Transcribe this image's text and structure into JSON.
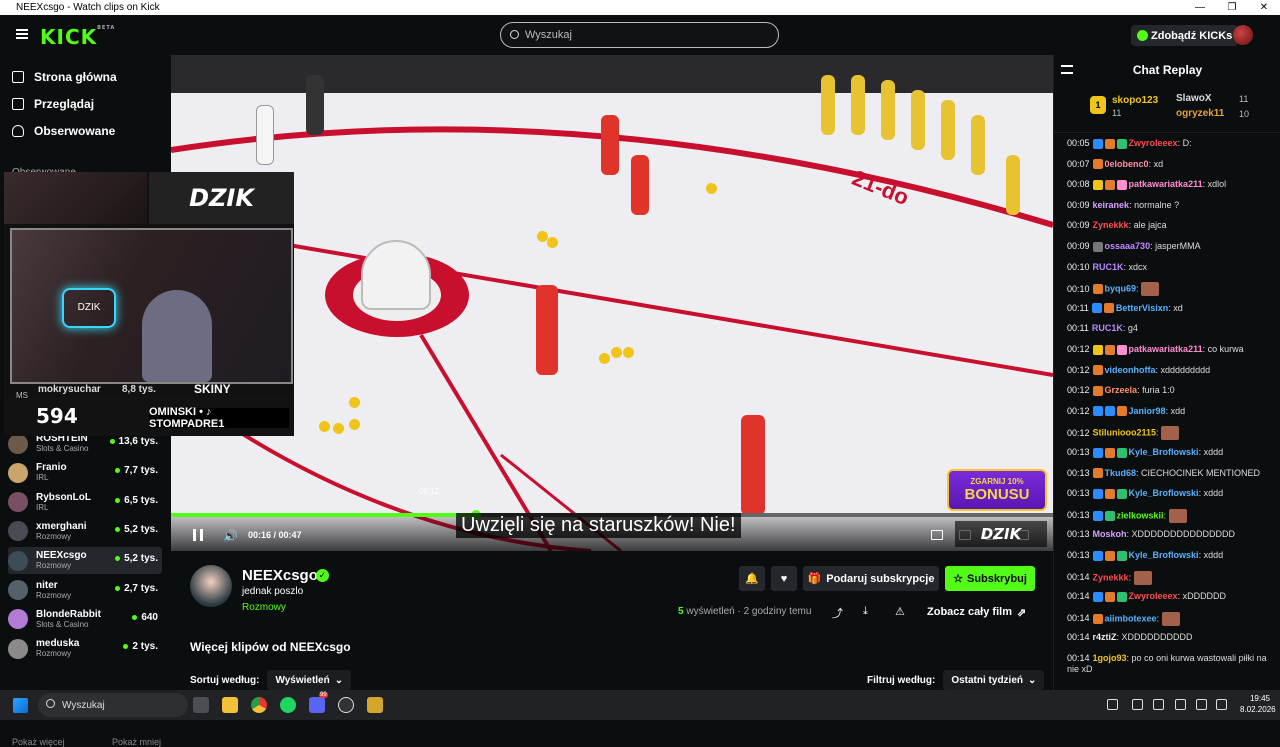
{
  "window": {
    "title": "NEEXcsgo - Watch clips on Kick",
    "controls": [
      "—",
      "❐",
      "✕"
    ]
  },
  "header": {
    "logo": "KICK",
    "logo_badge": "BETA",
    "search_placeholder": "Wyszukaj",
    "kicks_label": "Zdobądź KICKs"
  },
  "sidebar": {
    "nav": [
      {
        "label": "Strona główna",
        "icon": "home-icon"
      },
      {
        "label": "Przeglądaj",
        "icon": "browse-icon"
      },
      {
        "label": "Obserwowane",
        "icon": "heart-icon"
      }
    ],
    "followed_title": "Obserwowane",
    "overlay_row": {
      "name": "mokrysuchar",
      "viewers": "8,8 tys."
    },
    "channels": [
      {
        "name": "ROSHTEIN",
        "category": "Slots & Casino",
        "viewers": "13,6 tys.",
        "color": "#6b5a4a"
      },
      {
        "name": "Franio",
        "category": "IRL",
        "viewers": "7,7 tys.",
        "color": "#c9a46b"
      },
      {
        "name": "RybsonLoL",
        "category": "IRL",
        "viewers": "6,5 tys.",
        "color": "#7a4f63"
      },
      {
        "name": "xmerghani",
        "category": "Rozmowy",
        "viewers": "5,2 tys.",
        "color": "#4a4a55"
      },
      {
        "name": "NEEXcsgo",
        "category": "Rozmowy",
        "viewers": "5,2 tys.",
        "color": "#3d4d58",
        "active": true
      },
      {
        "name": "niter",
        "category": "Rozmowy",
        "viewers": "2,7 tys.",
        "color": "#55606a"
      },
      {
        "name": "BlondeRabbit",
        "category": "Slots & Casino",
        "viewers": "640",
        "color": "#b47bd6"
      },
      {
        "name": "meduska",
        "category": "Rozmowy",
        "viewers": "2 tys.",
        "color": "#8a8a8a"
      }
    ],
    "show_more": "Pokaż więcej",
    "show_less": "Pokaż mniej"
  },
  "overlay": {
    "banner": "DZIK",
    "counter": "594",
    "counter_label": "MS",
    "skiny": "SKINY",
    "tag": "OMINSKI • ♪ STOMPADRE1",
    "neon": "DZIK"
  },
  "video": {
    "caption": "Uwzięli się na staruszków! Nie!",
    "time": "00:16 / 00:47",
    "hover_time": "00:12",
    "progress": 0.346,
    "bonus_line1": "ZGARNIJ 10%",
    "bonus_line2": "BONUSU",
    "watermark": "DZIK",
    "court_text": "21-do"
  },
  "channel": {
    "name": "NEEXcsgo",
    "title": "jednak poszlo",
    "category": "Rozmowy",
    "views_count": "5",
    "views_label": "wyświetleń",
    "time_ago": "· 2 godziny temu",
    "gift_label": "Podaruj subskrypcje",
    "subscribe_label": "Subskrybuj",
    "full_film_label": "Zobacz cały film"
  },
  "clips": {
    "title": "Więcej klipów od NEEXcsgo",
    "sort_label": "Sortuj według:",
    "sort_value": "Wyświetleń",
    "filter_label": "Filtruj według:",
    "filter_value": "Ostatni tydzień"
  },
  "chat": {
    "title": "Chat Replay",
    "leaderboard": [
      {
        "rank": "1",
        "name": "skopo123",
        "value": "11"
      },
      {
        "name": "SlawoX",
        "value": "11"
      },
      {
        "name": "ogryzek11",
        "value": "10"
      }
    ],
    "messages": [
      {
        "t": "00:05",
        "user": "Zwyroleeex",
        "text": ": D:",
        "color": "#ff4d4d",
        "badges": [
          "#2b8cff",
          "#e37b2a",
          "#2fbf71"
        ]
      },
      {
        "t": "00:07",
        "user": "0elobenc0",
        "text": ": xd",
        "color": "#ff8fa3",
        "badges": [
          "#e37b2a"
        ]
      },
      {
        "t": "00:08",
        "user": "patkawariatka211",
        "text": ": xdlol",
        "color": "#ff8fd0",
        "badges": [
          "#f0c419",
          "#e37b2a",
          "#ff8fd0"
        ]
      },
      {
        "t": "00:09",
        "user": "keiranek",
        "text": ": normalne ?",
        "color": "#d6a0ff",
        "badges": []
      },
      {
        "t": "00:09",
        "user": "Zynekkk",
        "text": ": ale jajca",
        "color": "#ff4d4d",
        "badges": []
      },
      {
        "t": "00:09",
        "user": "ossaaa730",
        "text": ": jasperMMA",
        "color": "#c58aff",
        "badges": [
          "#777"
        ]
      },
      {
        "t": "00:10",
        "user": "RUC1K",
        "text": ": xdcx",
        "color": "#b98aff",
        "badges": []
      },
      {
        "t": "00:10",
        "user": "byqu69",
        "text": ":",
        "color": "#5ab0ff",
        "badges": [
          "#e37b2a"
        ],
        "emote": true
      },
      {
        "t": "00:11",
        "user": "BetterVisixn",
        "text": ": xd",
        "color": "#5ab0ff",
        "badges": [
          "#2b8cff",
          "#e37b2a"
        ]
      },
      {
        "t": "00:11",
        "user": "RUC1K",
        "text": ": g4",
        "color": "#b98aff",
        "badges": []
      },
      {
        "t": "00:12",
        "user": "patkawariatka211",
        "text": ": co kurwa",
        "color": "#ff8fd0",
        "badges": [
          "#f0c419",
          "#e37b2a",
          "#ff8fd0"
        ]
      },
      {
        "t": "00:12",
        "user": "videonhoffa",
        "text": ": xddddddddd",
        "color": "#5ab0ff",
        "badges": [
          "#e37b2a"
        ]
      },
      {
        "t": "00:12",
        "user": "Grzeela",
        "text": ": furia 1:0",
        "color": "#ff8f6b",
        "badges": [
          "#e37b2a"
        ]
      },
      {
        "t": "00:12",
        "user": "Janior98",
        "text": ": xdd",
        "color": "#5ab0ff",
        "badges": [
          "#2b8cff",
          "#2b8cff",
          "#e37b2a"
        ]
      },
      {
        "t": "00:12",
        "user": "Stiluniooo2115",
        "text": ":",
        "color": "#f0c419",
        "badges": [],
        "emote": true
      },
      {
        "t": "00:13",
        "user": "Kyle_Broflowski",
        "text": ": xddd",
        "color": "#5ab0ff",
        "badges": [
          "#2b8cff",
          "#e37b2a",
          "#2fbf71"
        ]
      },
      {
        "t": "00:13",
        "user": "Tkud68",
        "text": ": CIECHOCINEK MENTIONED",
        "color": "#5ab0ff",
        "badges": [
          "#e37b2a"
        ]
      },
      {
        "t": "00:13",
        "user": "Kyle_Broflowski",
        "text": ": xddd",
        "color": "#5ab0ff",
        "badges": [
          "#2b8cff",
          "#e37b2a",
          "#2fbf71"
        ]
      },
      {
        "t": "00:13",
        "user": "zielkowskii",
        "text": ":",
        "color": "#53fc18",
        "badges": [
          "#2b8cff",
          "#2fbf71"
        ],
        "emote": true
      },
      {
        "t": "00:13",
        "user": "Moskoh",
        "text": ": XDDDDDDDDDDDDDDD",
        "color": "#d6a0ff",
        "badges": []
      },
      {
        "t": "00:13",
        "user": "Kyle_Broflowski",
        "text": ": xddd",
        "color": "#5ab0ff",
        "badges": [
          "#2b8cff",
          "#e37b2a",
          "#2fbf71"
        ]
      },
      {
        "t": "00:14",
        "user": "Zynekkk",
        "text": ":",
        "color": "#ff4d4d",
        "badges": [],
        "emote": true
      },
      {
        "t": "00:14",
        "user": "Zwyroleeex",
        "text": ": xDDDDDD",
        "color": "#ff4d4d",
        "badges": [
          "#2b8cff",
          "#e37b2a",
          "#2fbf71"
        ]
      },
      {
        "t": "00:14",
        "user": "aiimbotexee",
        "text": ":",
        "color": "#5ab0ff",
        "badges": [
          "#e37b2a"
        ],
        "emote": true
      },
      {
        "t": "00:14",
        "user": "r4ztiZ",
        "text": ": XDDDDDDDDDD",
        "color": "#eee",
        "badges": []
      },
      {
        "t": "00:14",
        "user": "1gojo93",
        "text": ": po co oni kurwa wastowali piłki na nie xD",
        "color": "#f0c419",
        "badges": []
      }
    ]
  },
  "taskbar": {
    "search_placeholder": "Wyszukaj",
    "time": "19:45",
    "date": "8.02.2026",
    "discord_badge": "99"
  }
}
